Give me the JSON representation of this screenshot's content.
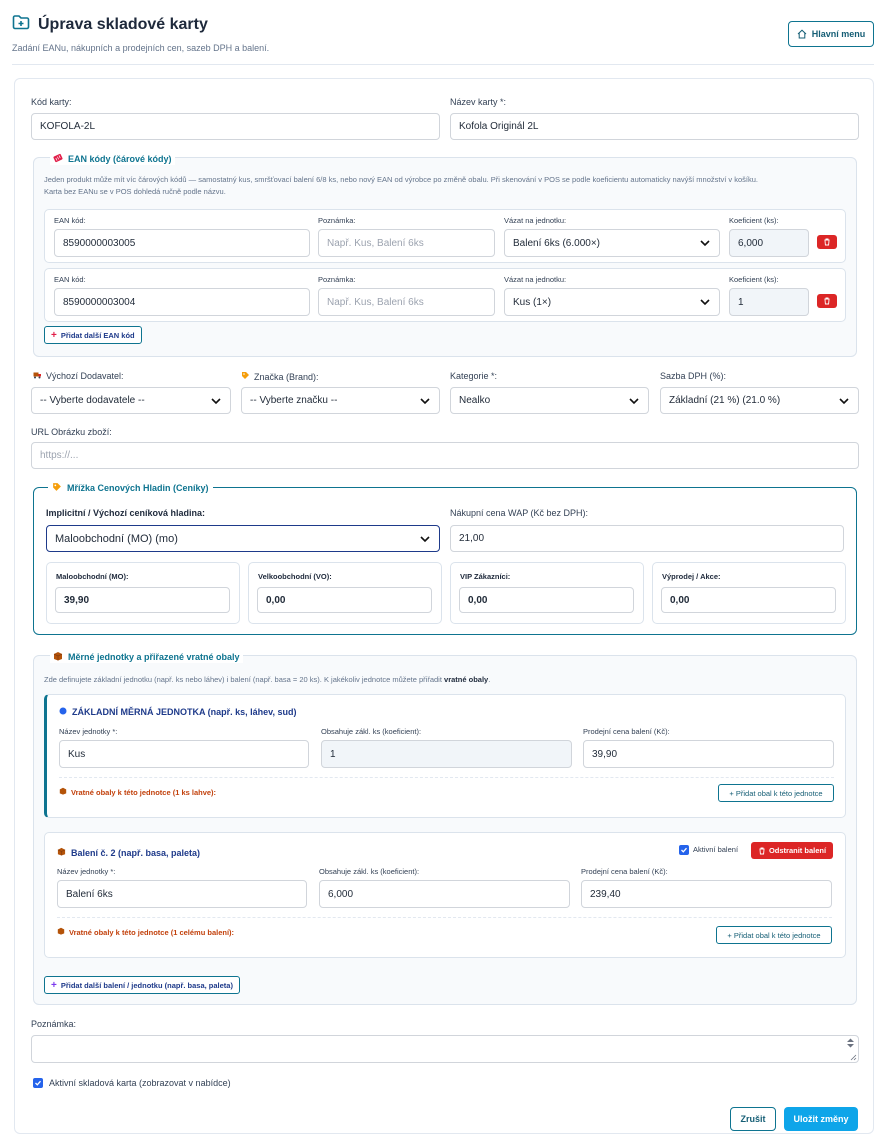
{
  "header": {
    "title": "Úprava skladové karty",
    "subtitle": "Zadání EANu, nákupních a prodejních cen, sazeb DPH a balení.",
    "main_menu": "Hlavní menu"
  },
  "card": {
    "code_label": "Kód karty:",
    "code_value": "KOFOLA-2L",
    "name_label": "Název karty *:",
    "name_value": "Kofola Originál 2L"
  },
  "ean": {
    "title": "EAN kódy (čárové kódy)",
    "note_line1": "Jeden produkt může mít víc čárových kódů — samostatný kus, smršťovací balení 6/8 ks, nebo nový EAN od výrobce po změně obalu. Při skenování v POS se podle koeficientu automaticky navýší množství v košíku.",
    "note_line2": "Karta bez EANu se v POS dohledá ručně podle názvu.",
    "col_ean": "EAN kód:",
    "col_note": "Poznámka:",
    "col_unit": "Vázat na jednotku:",
    "col_coef": "Koeficient (ks):",
    "note_placeholder": "Např. Kus, Balení 6ks",
    "rows": [
      {
        "code": "8590000003005",
        "unit": "Balení 6ks (6.000×)",
        "coef": "6,000"
      },
      {
        "code": "8590000003004",
        "unit": "Kus (1×)",
        "coef": "1"
      }
    ],
    "add_label": "Přidat další EAN kód"
  },
  "meta": {
    "supplier_label": "Výchozí Dodavatel:",
    "supplier_value": "-- Vyberte dodavatele --",
    "brand_label": "Značka (Brand):",
    "brand_value": "-- Vyberte značku --",
    "category_label": "Kategorie *:",
    "category_value": "Nealko",
    "vat_label": "Sazba DPH (%):",
    "vat_value": "Základní (21 %) (21.0 %)",
    "url_label": "URL Obrázku zboží:",
    "url_placeholder": "https://..."
  },
  "pricing": {
    "title": "Mřížka Cenových Hladin (Ceníky)",
    "default_label": "Implicitní / Výchozí ceníková hladina:",
    "default_value": "Maloobchodní (MO) (mo)",
    "wap_label": "Nákupní cena WAP (Kč bez DPH):",
    "wap_value": "21,00",
    "levels": [
      {
        "label": "Maloobchodní (MO):",
        "value": "39,90"
      },
      {
        "label": "Velkoobchodní (VO):",
        "value": "0,00"
      },
      {
        "label": "VIP Zákazníci:",
        "value": "0,00"
      },
      {
        "label": "Výprodej / Akce:",
        "value": "0,00"
      }
    ]
  },
  "units": {
    "title": "Měrné jednotky a přiřazené vratné obaly",
    "note_prefix": "Zde definujete základní jednotku (např. ks nebo láhev) i balení (např. basa = 20 ks). K jakékoliv jednotce můžete přiřadit ",
    "note_bold": "vratné obaly",
    "note_suffix": ".",
    "base_title": "ZÁKLADNÍ MĚRNÁ JEDNOTKA (např. ks, láhev, sud)",
    "col_name": "Název jednotky *:",
    "col_contains": "Obsahuje zákl. ks (koeficient):",
    "col_price": "Prodejní cena balení (Kč):",
    "base_name": "Kus",
    "base_contains": "1",
    "base_price": "39,90",
    "base_packing": "Vratné obaly k této jednotce (1 ks lahve):",
    "add_packing": "+ Přidat obal k této jednotce",
    "pack_title": "Balení č. 2 (např. basa, paleta)",
    "pack_active": "Aktivní balení",
    "pack_remove": "Odstranit balení",
    "pack_name": "Balení 6ks",
    "pack_contains": "6,000",
    "pack_price": "239,40",
    "pack_packing": "Vratné obaly k této jednotce (1 celému balení):",
    "add_unit": "Přidat další balení / jednotku (např. basa, paleta)"
  },
  "footer": {
    "note_label": "Poznámka:",
    "active_label": "Aktivní skladová karta (zobrazovat v nabídce)",
    "cancel": "Zrušit",
    "save": "Uložit změny"
  }
}
